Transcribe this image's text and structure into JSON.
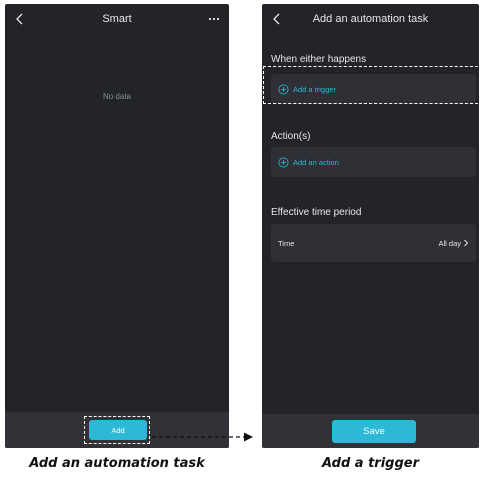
{
  "left_screen": {
    "title": "Smart",
    "empty_text": "No data",
    "add_label": "Add"
  },
  "right_screen": {
    "title": "Add an automation task",
    "when_section": "When either happens",
    "add_trigger_label": "Add a trigger",
    "actions_section": "Action(s)",
    "add_action_label": "Add an action",
    "time_section": "Effective time period",
    "time_label": "Time",
    "time_value": "All day",
    "save_label": "Save"
  },
  "captions": {
    "left": "Add an automation task",
    "right": "Add a trigger"
  },
  "colors": {
    "screen_bg": "#222427",
    "card_bg": "#2e3035",
    "accent": "#2bb9d6",
    "text": "#e6e6e6",
    "muted_text": "#8a8d92"
  },
  "icons": {
    "back": "chevron-left-icon",
    "more": "more-horizontal-icon",
    "add": "plus-circle-icon",
    "chevron": "chevron-right-icon"
  }
}
